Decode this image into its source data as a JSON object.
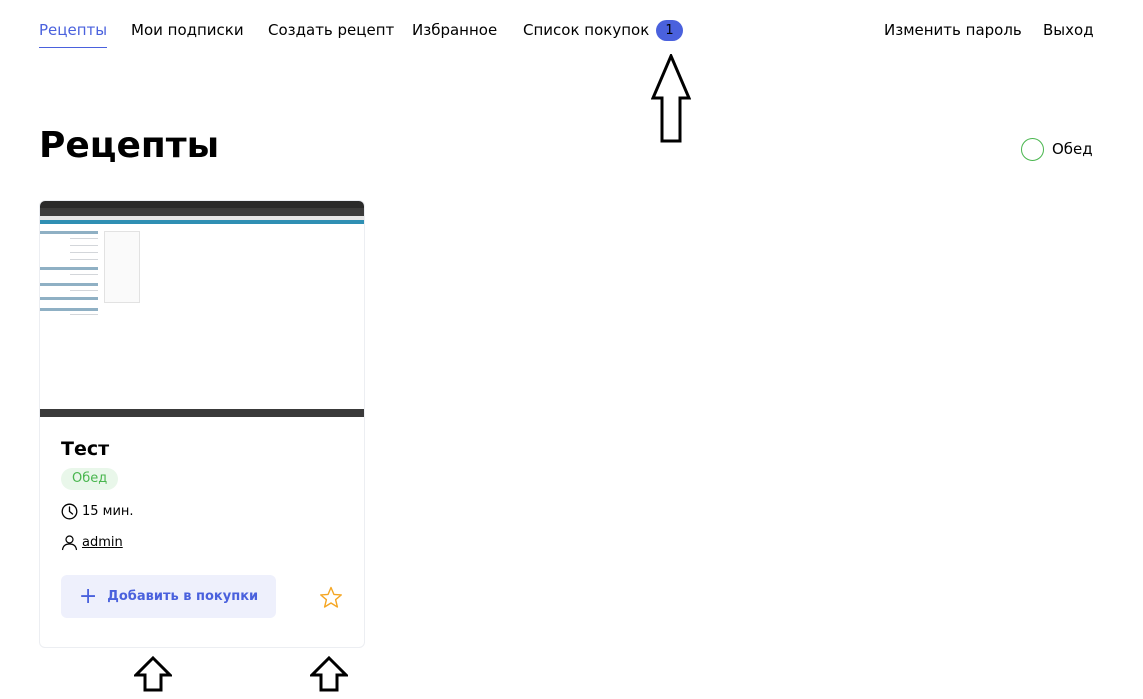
{
  "nav": {
    "recipes": "Рецепты",
    "subscriptions": "Мои подписки",
    "create_recipe": "Создать рецепт",
    "favorites": "Избранное",
    "shopping_list": "Список покупок",
    "shopping_count": "1",
    "change_password": "Изменить пароль",
    "logout": "Выход"
  },
  "page": {
    "title": "Рецепты",
    "filter_tag": "Обед"
  },
  "recipe_card": {
    "title": "Тест",
    "tag": "Обед",
    "cooking_time": "15 мин.",
    "author": "admin",
    "add_button": "Добавить в покупки"
  },
  "colors": {
    "accent": "#4a61dd",
    "tag_green": "#49b64e",
    "star": "#f5a623"
  }
}
